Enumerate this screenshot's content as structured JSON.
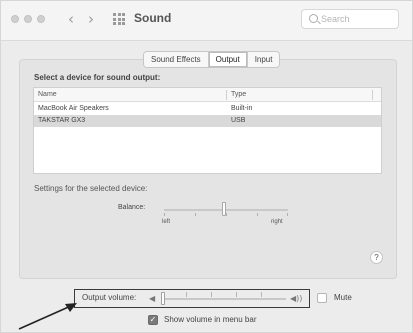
{
  "window": {
    "title": "Sound",
    "back_glyph": "‹",
    "forward_glyph": "›",
    "search": {
      "placeholder": "Search"
    }
  },
  "tabs": [
    {
      "label": "Sound Effects",
      "active": false
    },
    {
      "label": "Output",
      "active": true
    },
    {
      "label": "Input",
      "active": false
    }
  ],
  "output": {
    "section_label": "Select a device for sound output:",
    "columns": [
      "Name",
      "Type"
    ],
    "devices": [
      {
        "name": "MacBook Air Speakers",
        "type": "Built-in",
        "selected": false
      },
      {
        "name": "TAKSTAR GX3",
        "type": "USB",
        "selected": true
      }
    ],
    "settings_label": "Settings for the selected device:",
    "balance": {
      "label": "Balance:",
      "left_label": "left",
      "right_label": "right",
      "value": 0.5
    }
  },
  "help_label": "?",
  "volume": {
    "label": "Output volume:",
    "low_icon": "speaker-low-icon",
    "high_icon": "speaker-high-icon",
    "low_glyph": "◀",
    "high_glyph": "◀))",
    "level": 0.0,
    "mute_label": "Mute",
    "mute_checked": false,
    "show_in_menubar_label": "Show volume in menu bar",
    "show_in_menubar_checked": true,
    "check_glyph": "✓"
  },
  "colors": {
    "highlight_border": "#3a3a3a",
    "selected_row": "#d9d9d9"
  }
}
